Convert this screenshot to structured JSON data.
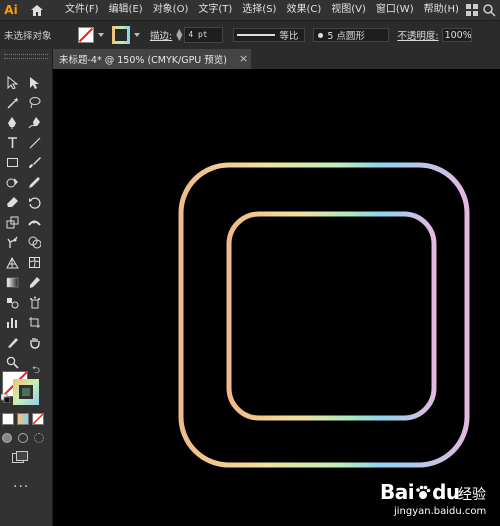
{
  "app": {
    "logo": "Ai"
  },
  "menu": [
    "文件(F)",
    "编辑(E)",
    "对象(O)",
    "文字(T)",
    "选择(S)",
    "效果(C)",
    "视图(V)",
    "窗口(W)",
    "帮助(H)"
  ],
  "control_bar": {
    "selection_status": "未选择对象",
    "stroke_label": "描边:",
    "stroke_weight": "4 pt",
    "stroke_profile": "等比",
    "brush_definition": "5 点圆形",
    "opacity_label": "不透明度:",
    "opacity_value": "100%"
  },
  "document_tab": {
    "title": "未标题-4* @ 150% (CMYK/GPU 预览)",
    "close": "×"
  },
  "toolbar": {
    "tools": [
      "selection-tool",
      "direct-selection-tool",
      "magic-wand-tool",
      "lasso-tool",
      "pen-tool",
      "curvature-tool",
      "type-tool",
      "line-tool",
      "rectangle-tool",
      "paintbrush-tool",
      "shaper-tool",
      "pencil-tool",
      "eraser-tool",
      "rotate-tool",
      "scale-tool",
      "width-tool",
      "puppet-warp-tool",
      "shape-builder-tool",
      "perspective-grid-tool",
      "mesh-tool",
      "gradient-tool",
      "eyedropper-tool",
      "blend-tool",
      "symbol-sprayer-tool",
      "column-graph-tool",
      "artboard-tool",
      "slice-tool",
      "hand-tool",
      "eyedropper-alt-tool",
      "zoom-tool"
    ],
    "more": "..."
  },
  "colors": {
    "gradient_stops": [
      "#f2b98a",
      "#f2e39a",
      "#bff0b8",
      "#8fd4f2",
      "#e6b8e0"
    ]
  },
  "watermark": {
    "brand": "Bai",
    "brand_suffix": "du",
    "product": "经验",
    "url": "jingyan.baidu.com"
  }
}
